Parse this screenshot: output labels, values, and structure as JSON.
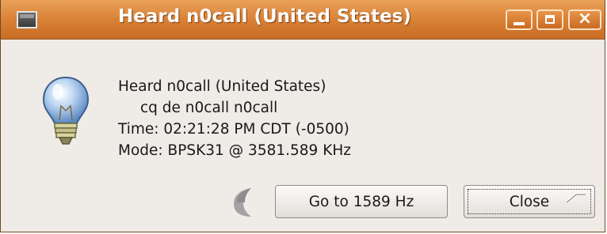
{
  "window": {
    "title": "Heard n0call (United States)"
  },
  "titlebar_buttons": {
    "minimize": "minimize-icon",
    "maximize": "maximize-icon",
    "close": "×"
  },
  "message": {
    "line1": "Heard n0call (United States)",
    "line2": "cq de n0call n0call",
    "line3": "Time: 02:21:28 PM CDT (-0500)",
    "line4": "Mode: BPSK31 @ 3581.589 KHz"
  },
  "buttons": {
    "goto_label": "Go to 1589 Hz",
    "close_label": "Close"
  },
  "icons": {
    "info": "lightbulb-icon",
    "busy": "spinner-icon",
    "window_menu": "window-menu-icon"
  }
}
